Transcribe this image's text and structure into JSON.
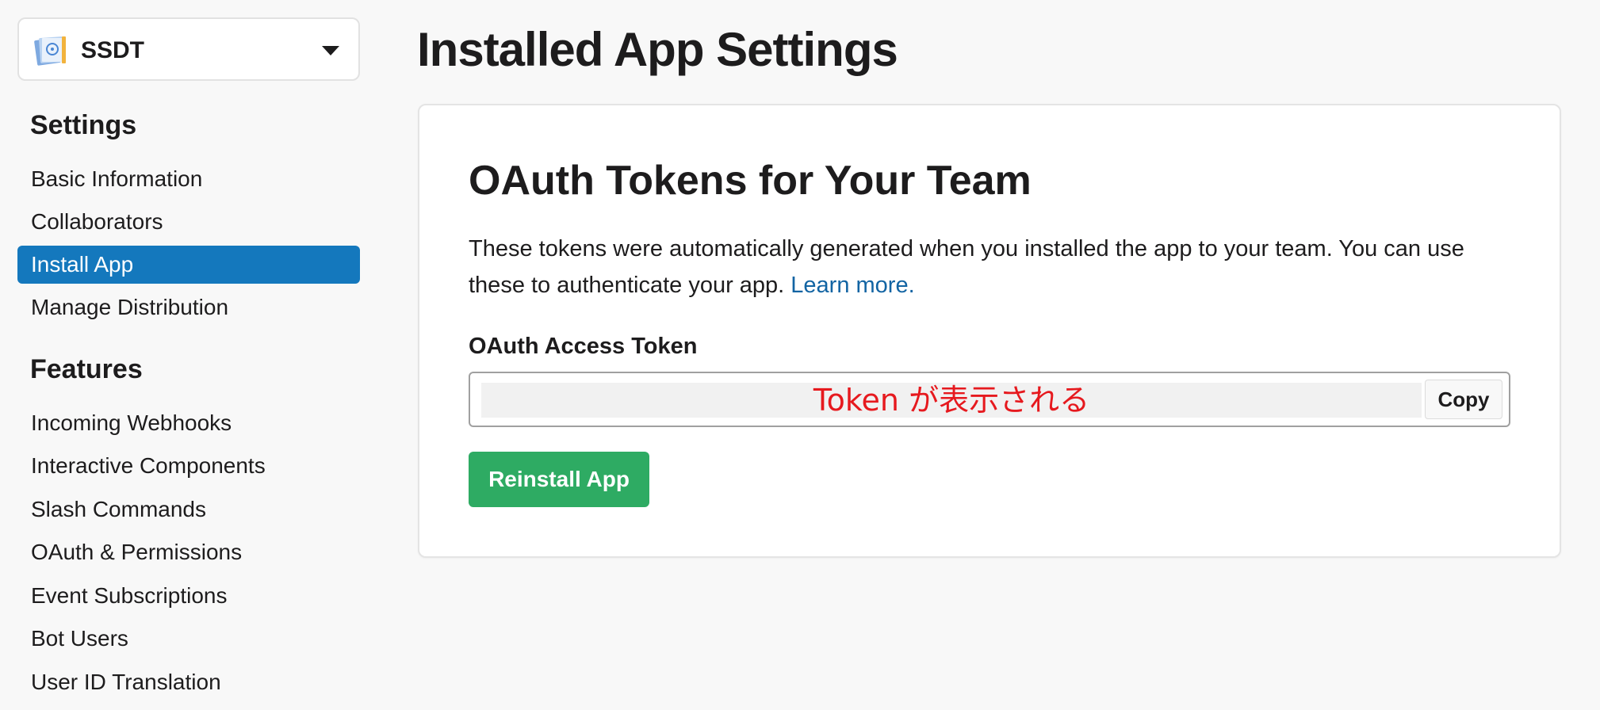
{
  "app_switcher": {
    "app_name": "SSDT",
    "icon": "app-book-icon"
  },
  "sidebar": {
    "settings_title": "Settings",
    "settings_items": [
      {
        "label": "Basic Information",
        "active": false
      },
      {
        "label": "Collaborators",
        "active": false
      },
      {
        "label": "Install App",
        "active": true
      },
      {
        "label": "Manage Distribution",
        "active": false
      }
    ],
    "features_title": "Features",
    "features_items": [
      {
        "label": "Incoming Webhooks"
      },
      {
        "label": "Interactive Components"
      },
      {
        "label": "Slash Commands"
      },
      {
        "label": "OAuth & Permissions"
      },
      {
        "label": "Event Subscriptions"
      },
      {
        "label": "Bot Users"
      },
      {
        "label": "User ID Translation"
      }
    ]
  },
  "main": {
    "page_title": "Installed App Settings",
    "card_title": "OAuth Tokens for Your Team",
    "description": "These tokens were automatically generated when you installed the app to your team. You can use these to authenticate your app.",
    "learn_more": "Learn more.",
    "token_label": "OAuth Access Token",
    "token_value": "Token が表示される",
    "copy_label": "Copy",
    "reinstall_label": "Reinstall App"
  },
  "colors": {
    "active_nav": "#1478bd",
    "link": "#1264a3",
    "reinstall_button": "#2eab63",
    "token_annotation": "#e6191e"
  }
}
